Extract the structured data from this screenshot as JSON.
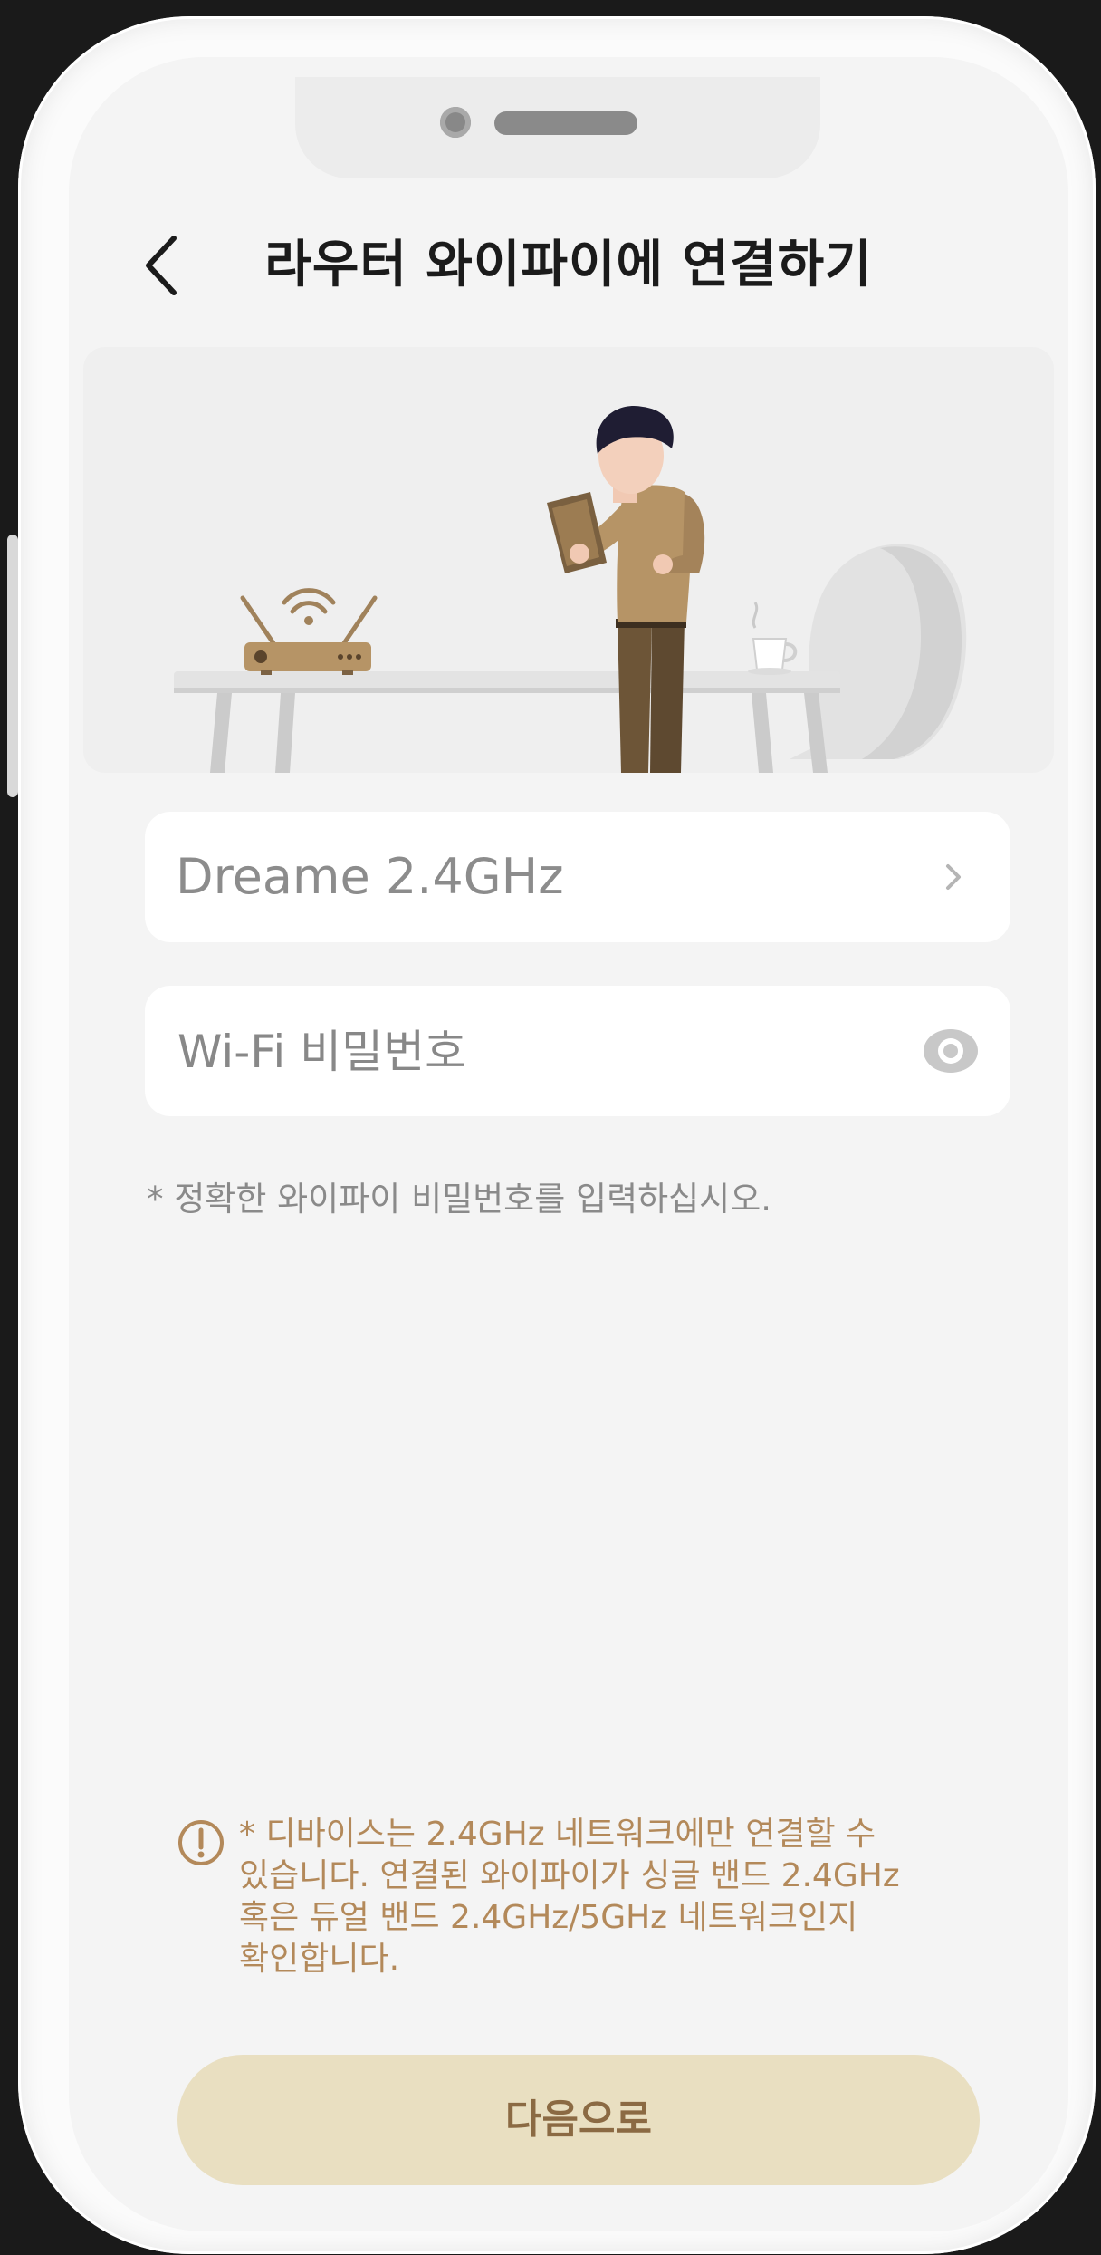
{
  "header": {
    "title": "라우터 와이파이에 연결하기"
  },
  "wifi": {
    "ssid": "Dreame 2.4GHz"
  },
  "password": {
    "placeholder": "Wi-Fi 비밀번호",
    "value": ""
  },
  "hint": "* 정확한 와이파이 비밀번호를 입력하십시오.",
  "notice": "* 디바이스는 2.4GHz 네트워크에만 연결할 수\n있습니다. 연결된 와이파이가 싱글 밴드 2.4GHz\n혹은 듀얼 밴드 2.4GHz/5GHz 네트워크인지\n확인합니다.",
  "next_button": "다음으로",
  "icons": {
    "back": "chevron-left-icon",
    "select": "chevron-right-icon",
    "visibility": "eye-icon",
    "notice": "exclamation-circle-icon"
  },
  "colors": {
    "accent": "#b3895a",
    "button_bg": "#e9dfc1",
    "button_text": "#8b6a43",
    "screen_bg": "#f4f4f4"
  }
}
